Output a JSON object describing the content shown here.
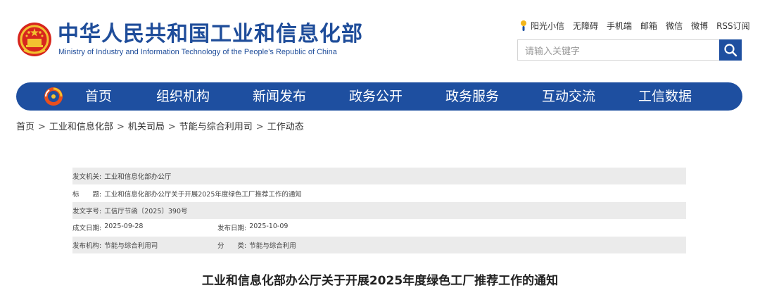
{
  "site": {
    "title_cn": "中华人民共和国工业和信息化部",
    "title_en": "Ministry of Industry and Information Technology of the People’s Republic of China"
  },
  "toplinks": [
    "阳光小信",
    "无障碍",
    "手机端",
    "邮箱",
    "微信",
    "微博",
    "RSS订阅"
  ],
  "search": {
    "placeholder": "请输入关键字"
  },
  "nav": [
    "首页",
    "组织机构",
    "新闻发布",
    "政务公开",
    "政务服务",
    "互动交流",
    "工信数据"
  ],
  "breadcrumb": [
    "首页",
    "工业和信息化部",
    "机关司局",
    "节能与综合利用司",
    "工作动态"
  ],
  "breadcrumb_sep": ">",
  "info": {
    "issuer_label": "发文机关:",
    "issuer": "工业和信息化部办公厅",
    "title_label": "标　　题:",
    "title": "工业和信息化部办公厅关于开展2025年度绿色工厂推荐工作的通知",
    "doc_no_label": "发文字号:",
    "doc_no": "工信厅节函〔2025〕390号",
    "written_label": "成文日期:",
    "written": "2025-09-28",
    "published_label": "发布日期:",
    "published": "2025-10-09",
    "agency_label": "发布机构:",
    "agency": "节能与综合利用司",
    "category_label": "分　　类:",
    "category": "节能与综合利用"
  },
  "document": {
    "title": "工业和信息化部办公厅关于开展2025年度绿色工厂推荐工作的通知"
  },
  "colors": {
    "brand_blue": "#1e4fa0",
    "emblem_red": "#d7261e",
    "emblem_gold": "#f2c230",
    "row_shade": "#ebebeb"
  },
  "icons": {
    "emblem": "national-emblem-icon",
    "sun": "sun-icon",
    "search": "search-icon",
    "nav_logo": "miit-logo-icon"
  }
}
